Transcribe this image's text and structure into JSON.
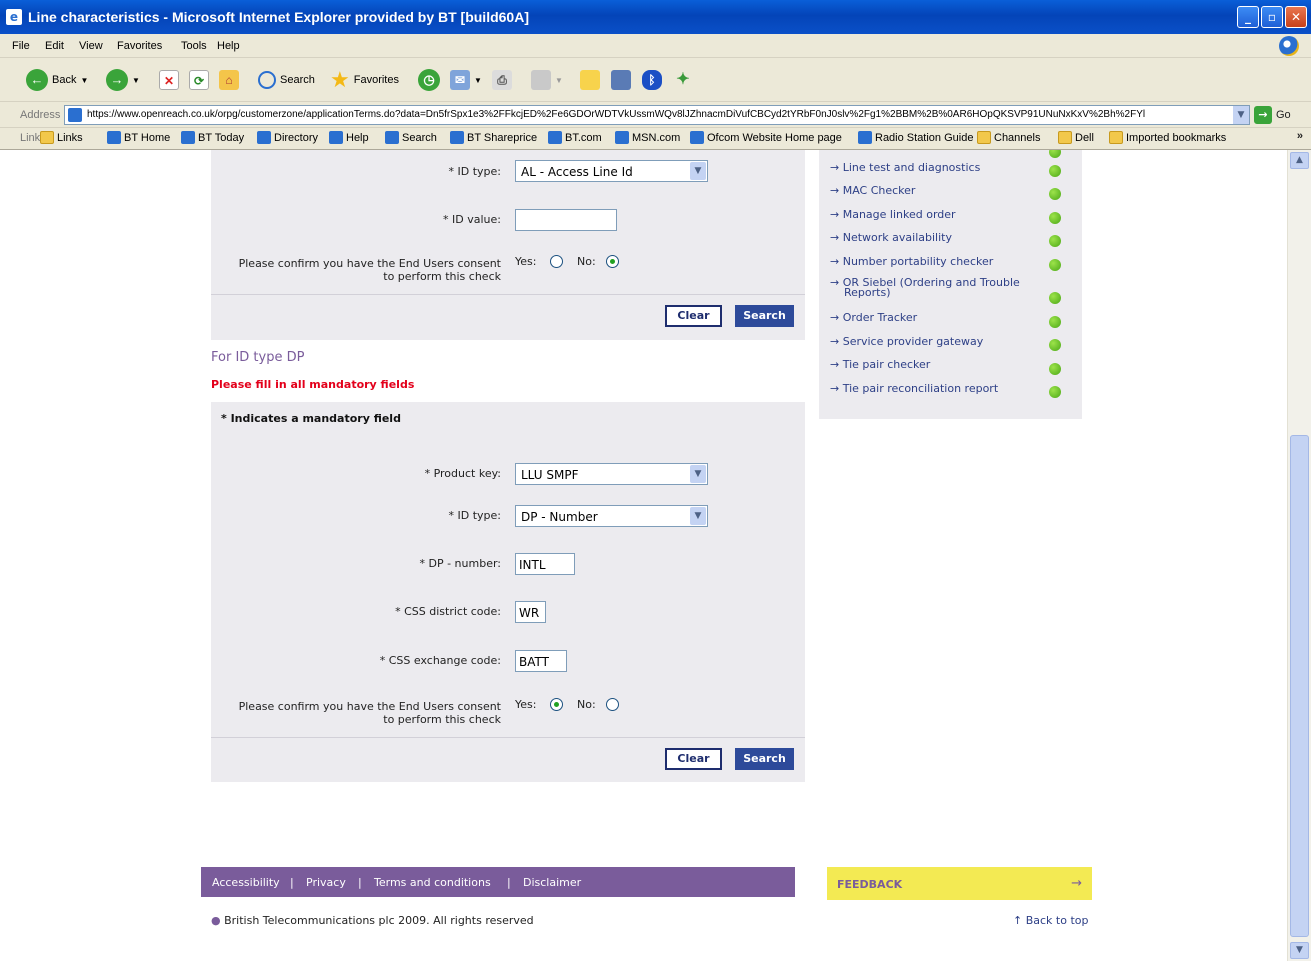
{
  "window": {
    "title": "Line characteristics - Microsoft Internet Explorer provided by BT [build60A]",
    "min": "_",
    "max": "▫",
    "close": "✕"
  },
  "menu": [
    "File",
    "Edit",
    "View",
    "Favorites",
    "Tools",
    "Help"
  ],
  "toolbar": {
    "back": "Back",
    "search": "Search",
    "favorites": "Favorites"
  },
  "address": {
    "label": "Address",
    "url": "https://www.openreach.co.uk/orpg/customerzone/applicationTerms.do?data=Dn5frSpx1e3%2FFkcjED%2Fe6GDOrWDTVkUssmWQv8lJZhnacmDiVufCBCyd2tYRbF0nJ0slv%2Fg1%2BBM%2B%0AR6HOpQKSVP91UNuNxKxV%2Bh%2FYl",
    "go": "Go"
  },
  "links": {
    "label": "Links",
    "items": [
      "Links",
      "BT Home",
      "BT Today",
      "Directory",
      "Help",
      "Search",
      "BT Shareprice",
      "BT.com",
      "MSN.com",
      "Ofcom Website Home page",
      "Radio Station Guide",
      "Channels",
      "Dell",
      "Imported bookmarks"
    ],
    "more": "»"
  },
  "form1": {
    "id_type_label": "* ID type:",
    "id_type_value": "AL - Access Line Id",
    "id_value_label": "* ID value:",
    "id_value": "",
    "consent_line1": "Please confirm you have the End Users consent",
    "consent_line2": "to perform this check",
    "yes": "Yes:",
    "no": "No:",
    "clear": "Clear",
    "search": "Search"
  },
  "form2": {
    "heading": "For ID type DP",
    "warning": "Please fill in all mandatory fields",
    "mandatory_note": "* Indicates a mandatory field",
    "product_key_label": "* Product key:",
    "product_key_value": "LLU SMPF",
    "id_type_label": "* ID type:",
    "id_type_value": "DP - Number",
    "dp_number_label": "* DP - number:",
    "dp_number_value": "INTL",
    "css_district_label": "* CSS district code:",
    "css_district_value": "WR",
    "css_exchange_label": "* CSS exchange code:",
    "css_exchange_value": "BATT",
    "consent_line1": "Please confirm you have the End Users consent",
    "consent_line2": "to perform this check",
    "yes": "Yes:",
    "no": "No:",
    "clear": "Clear",
    "search": "Search"
  },
  "sidebar": {
    "arrow": "→",
    "items": [
      "Line test and diagnostics",
      "MAC Checker",
      "Manage linked order",
      "Network availability",
      "Number portability checker",
      "OR Siebel (Ordering and Trouble",
      "Order Tracker",
      "Service provider gateway",
      "Tie pair checker",
      "Tie pair reconciliation report"
    ],
    "item6_line2": "Reports)"
  },
  "footer": {
    "links": [
      "Accessibility",
      "Privacy",
      "Terms and conditions",
      "Disclaimer"
    ],
    "sep": "|",
    "feedback": "FEEDBACK",
    "feedback_arrow": "→",
    "copyright": "British Telecommunications plc 2009. All rights reserved",
    "back_to_top": "↑ Back to top"
  },
  "colors": {
    "purple": "#7a5c9b",
    "warning": "#e3001b",
    "feedback_bg": "#f3ea53",
    "ok_dot": "#4aa716"
  }
}
